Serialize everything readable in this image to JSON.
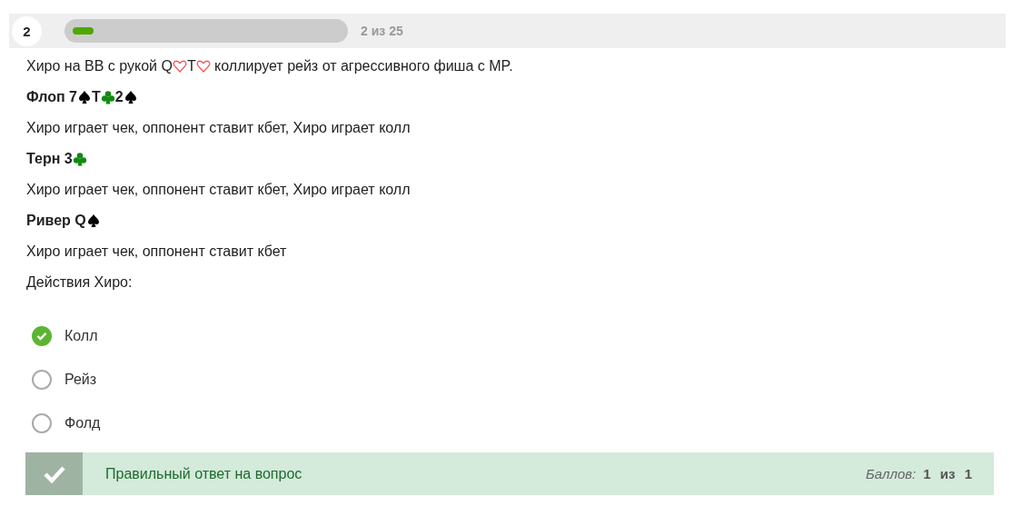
{
  "header": {
    "number": "2",
    "progress": {
      "level": 0.08
    },
    "counter": "2 из 25"
  },
  "question": [
    {
      "kind": "text",
      "parts": [
        {
          "kind": "text",
          "text": "Хиро на BB с рукой Q"
        },
        {
          "kind": "hearts"
        },
        {
          "kind": "text",
          "text": "T"
        },
        {
          "kind": "hearts"
        },
        {
          "kind": "text",
          "text": " коллирует рейз от агрессивного фиша с MP."
        }
      ]
    },
    {
      "kind": "heading",
      "parts": [
        {
          "kind": "text",
          "text": "Флоп 7"
        },
        {
          "kind": "spades"
        },
        {
          "kind": "text",
          "text": "T"
        },
        {
          "kind": "clubs"
        },
        {
          "kind": "text",
          "text": "2"
        },
        {
          "kind": "spades"
        }
      ]
    },
    {
      "kind": "text",
      "parts": [
        {
          "kind": "text",
          "text": "Хиро играет чек, оппонент ставит кбет, Хиро играет колл"
        }
      ]
    },
    {
      "kind": "heading",
      "parts": [
        {
          "kind": "text",
          "text": "Терн 3"
        },
        {
          "kind": "clubs"
        }
      ]
    },
    {
      "kind": "text",
      "parts": [
        {
          "kind": "text",
          "text": "Хиро играет чек, оппонент ставит кбет, Хиро играет колл"
        }
      ]
    },
    {
      "kind": "heading",
      "parts": [
        {
          "kind": "text",
          "text": "Ривер Q"
        },
        {
          "kind": "spades"
        }
      ]
    },
    {
      "kind": "text",
      "parts": [
        {
          "kind": "text",
          "text": "Хиро играет чек, оппонент ставит кбет"
        }
      ]
    },
    {
      "kind": "text",
      "parts": [
        {
          "kind": "text",
          "text": "Действия Хиро:"
        }
      ]
    }
  ],
  "options": [
    {
      "label": "Колл",
      "selected": true
    },
    {
      "label": "Рейз",
      "selected": false
    },
    {
      "label": "Фолд",
      "selected": false
    }
  ],
  "feedback": {
    "correct": true,
    "message": "Правильный ответ на вопрос",
    "score_label": "Баллов:",
    "score_value": "1 из 1"
  }
}
